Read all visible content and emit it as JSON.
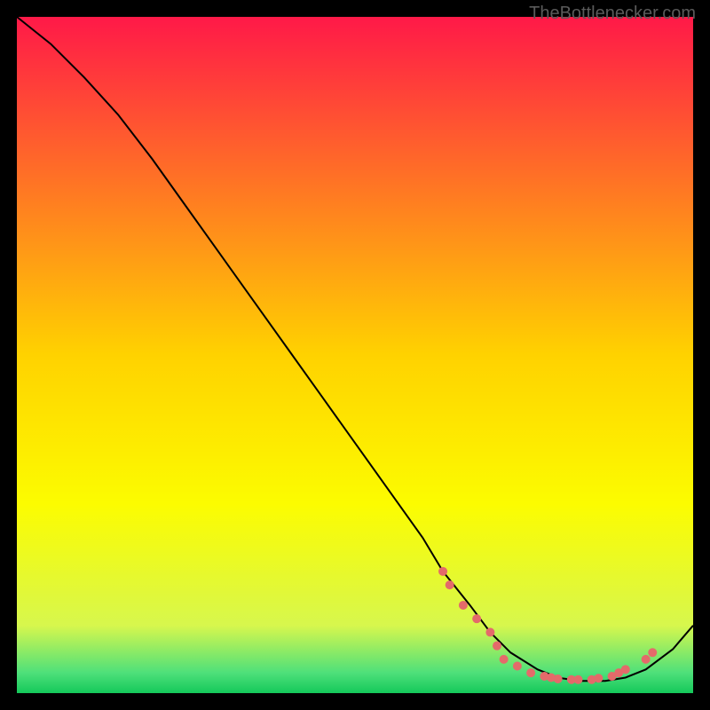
{
  "watermark": "TheBottlenecker.com",
  "chart_data": {
    "type": "line",
    "title": "",
    "xlabel": "",
    "ylabel": "",
    "xlim": [
      0,
      100
    ],
    "ylim": [
      0,
      100
    ],
    "curve": {
      "x": [
        0,
        5,
        10,
        15,
        20,
        25,
        30,
        35,
        40,
        45,
        50,
        55,
        60,
        63,
        67,
        70,
        73,
        77,
        80,
        83,
        87,
        90,
        93,
        97,
        100
      ],
      "y": [
        100,
        96,
        91,
        85.5,
        79,
        72,
        65,
        58,
        51,
        44,
        37,
        30,
        23,
        18,
        13,
        9,
        6,
        3.5,
        2.3,
        1.8,
        1.8,
        2.3,
        3.5,
        6.5,
        10
      ]
    },
    "markers": {
      "color": "#e46a6a",
      "points": [
        {
          "x": 63,
          "y": 18
        },
        {
          "x": 64,
          "y": 16
        },
        {
          "x": 66,
          "y": 13
        },
        {
          "x": 68,
          "y": 11
        },
        {
          "x": 70,
          "y": 9
        },
        {
          "x": 71,
          "y": 7
        },
        {
          "x": 72,
          "y": 5
        },
        {
          "x": 74,
          "y": 4
        },
        {
          "x": 76,
          "y": 3
        },
        {
          "x": 78,
          "y": 2.5
        },
        {
          "x": 79,
          "y": 2.3
        },
        {
          "x": 80,
          "y": 2.1
        },
        {
          "x": 82,
          "y": 2
        },
        {
          "x": 83,
          "y": 2
        },
        {
          "x": 85,
          "y": 2
        },
        {
          "x": 86,
          "y": 2.2
        },
        {
          "x": 88,
          "y": 2.5
        },
        {
          "x": 89,
          "y": 3
        },
        {
          "x": 90,
          "y": 3.5
        },
        {
          "x": 93,
          "y": 5
        },
        {
          "x": 94,
          "y": 6
        }
      ]
    },
    "gradient_stops": [
      {
        "offset": 0,
        "color": "#ff1948"
      },
      {
        "offset": 0.5,
        "color": "#ffd200"
      },
      {
        "offset": 0.72,
        "color": "#fcfc00"
      },
      {
        "offset": 0.9,
        "color": "#d7f74d"
      },
      {
        "offset": 0.97,
        "color": "#4ee07a"
      },
      {
        "offset": 1,
        "color": "#14c85a"
      }
    ]
  }
}
